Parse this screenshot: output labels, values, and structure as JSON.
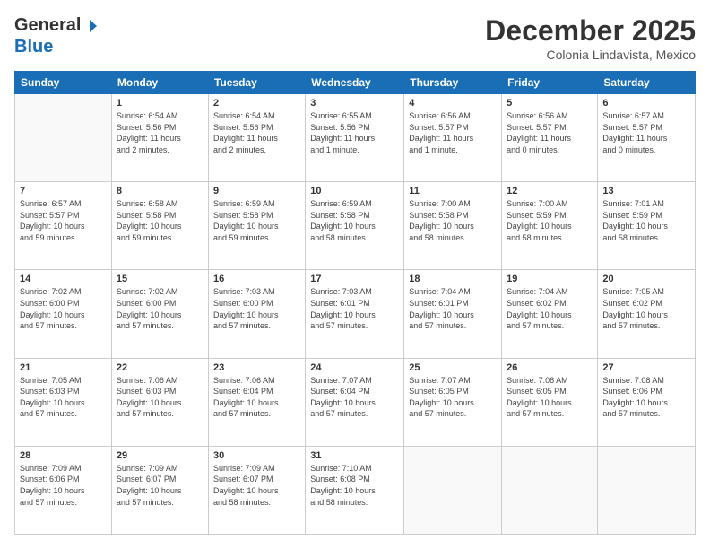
{
  "logo": {
    "line1": "General",
    "line2": "Blue"
  },
  "title": "December 2025",
  "subtitle": "Colonia Lindavista, Mexico",
  "days_of_week": [
    "Sunday",
    "Monday",
    "Tuesday",
    "Wednesday",
    "Thursday",
    "Friday",
    "Saturday"
  ],
  "weeks": [
    [
      {
        "day": "",
        "info": ""
      },
      {
        "day": "1",
        "info": "Sunrise: 6:54 AM\nSunset: 5:56 PM\nDaylight: 11 hours\nand 2 minutes."
      },
      {
        "day": "2",
        "info": "Sunrise: 6:54 AM\nSunset: 5:56 PM\nDaylight: 11 hours\nand 2 minutes."
      },
      {
        "day": "3",
        "info": "Sunrise: 6:55 AM\nSunset: 5:56 PM\nDaylight: 11 hours\nand 1 minute."
      },
      {
        "day": "4",
        "info": "Sunrise: 6:56 AM\nSunset: 5:57 PM\nDaylight: 11 hours\nand 1 minute."
      },
      {
        "day": "5",
        "info": "Sunrise: 6:56 AM\nSunset: 5:57 PM\nDaylight: 11 hours\nand 0 minutes."
      },
      {
        "day": "6",
        "info": "Sunrise: 6:57 AM\nSunset: 5:57 PM\nDaylight: 11 hours\nand 0 minutes."
      }
    ],
    [
      {
        "day": "7",
        "info": "Sunrise: 6:57 AM\nSunset: 5:57 PM\nDaylight: 10 hours\nand 59 minutes."
      },
      {
        "day": "8",
        "info": "Sunrise: 6:58 AM\nSunset: 5:58 PM\nDaylight: 10 hours\nand 59 minutes."
      },
      {
        "day": "9",
        "info": "Sunrise: 6:59 AM\nSunset: 5:58 PM\nDaylight: 10 hours\nand 59 minutes."
      },
      {
        "day": "10",
        "info": "Sunrise: 6:59 AM\nSunset: 5:58 PM\nDaylight: 10 hours\nand 58 minutes."
      },
      {
        "day": "11",
        "info": "Sunrise: 7:00 AM\nSunset: 5:58 PM\nDaylight: 10 hours\nand 58 minutes."
      },
      {
        "day": "12",
        "info": "Sunrise: 7:00 AM\nSunset: 5:59 PM\nDaylight: 10 hours\nand 58 minutes."
      },
      {
        "day": "13",
        "info": "Sunrise: 7:01 AM\nSunset: 5:59 PM\nDaylight: 10 hours\nand 58 minutes."
      }
    ],
    [
      {
        "day": "14",
        "info": "Sunrise: 7:02 AM\nSunset: 6:00 PM\nDaylight: 10 hours\nand 57 minutes."
      },
      {
        "day": "15",
        "info": "Sunrise: 7:02 AM\nSunset: 6:00 PM\nDaylight: 10 hours\nand 57 minutes."
      },
      {
        "day": "16",
        "info": "Sunrise: 7:03 AM\nSunset: 6:00 PM\nDaylight: 10 hours\nand 57 minutes."
      },
      {
        "day": "17",
        "info": "Sunrise: 7:03 AM\nSunset: 6:01 PM\nDaylight: 10 hours\nand 57 minutes."
      },
      {
        "day": "18",
        "info": "Sunrise: 7:04 AM\nSunset: 6:01 PM\nDaylight: 10 hours\nand 57 minutes."
      },
      {
        "day": "19",
        "info": "Sunrise: 7:04 AM\nSunset: 6:02 PM\nDaylight: 10 hours\nand 57 minutes."
      },
      {
        "day": "20",
        "info": "Sunrise: 7:05 AM\nSunset: 6:02 PM\nDaylight: 10 hours\nand 57 minutes."
      }
    ],
    [
      {
        "day": "21",
        "info": "Sunrise: 7:05 AM\nSunset: 6:03 PM\nDaylight: 10 hours\nand 57 minutes."
      },
      {
        "day": "22",
        "info": "Sunrise: 7:06 AM\nSunset: 6:03 PM\nDaylight: 10 hours\nand 57 minutes."
      },
      {
        "day": "23",
        "info": "Sunrise: 7:06 AM\nSunset: 6:04 PM\nDaylight: 10 hours\nand 57 minutes."
      },
      {
        "day": "24",
        "info": "Sunrise: 7:07 AM\nSunset: 6:04 PM\nDaylight: 10 hours\nand 57 minutes."
      },
      {
        "day": "25",
        "info": "Sunrise: 7:07 AM\nSunset: 6:05 PM\nDaylight: 10 hours\nand 57 minutes."
      },
      {
        "day": "26",
        "info": "Sunrise: 7:08 AM\nSunset: 6:05 PM\nDaylight: 10 hours\nand 57 minutes."
      },
      {
        "day": "27",
        "info": "Sunrise: 7:08 AM\nSunset: 6:06 PM\nDaylight: 10 hours\nand 57 minutes."
      }
    ],
    [
      {
        "day": "28",
        "info": "Sunrise: 7:09 AM\nSunset: 6:06 PM\nDaylight: 10 hours\nand 57 minutes."
      },
      {
        "day": "29",
        "info": "Sunrise: 7:09 AM\nSunset: 6:07 PM\nDaylight: 10 hours\nand 57 minutes."
      },
      {
        "day": "30",
        "info": "Sunrise: 7:09 AM\nSunset: 6:07 PM\nDaylight: 10 hours\nand 58 minutes."
      },
      {
        "day": "31",
        "info": "Sunrise: 7:10 AM\nSunset: 6:08 PM\nDaylight: 10 hours\nand 58 minutes."
      },
      {
        "day": "",
        "info": ""
      },
      {
        "day": "",
        "info": ""
      },
      {
        "day": "",
        "info": ""
      }
    ]
  ]
}
